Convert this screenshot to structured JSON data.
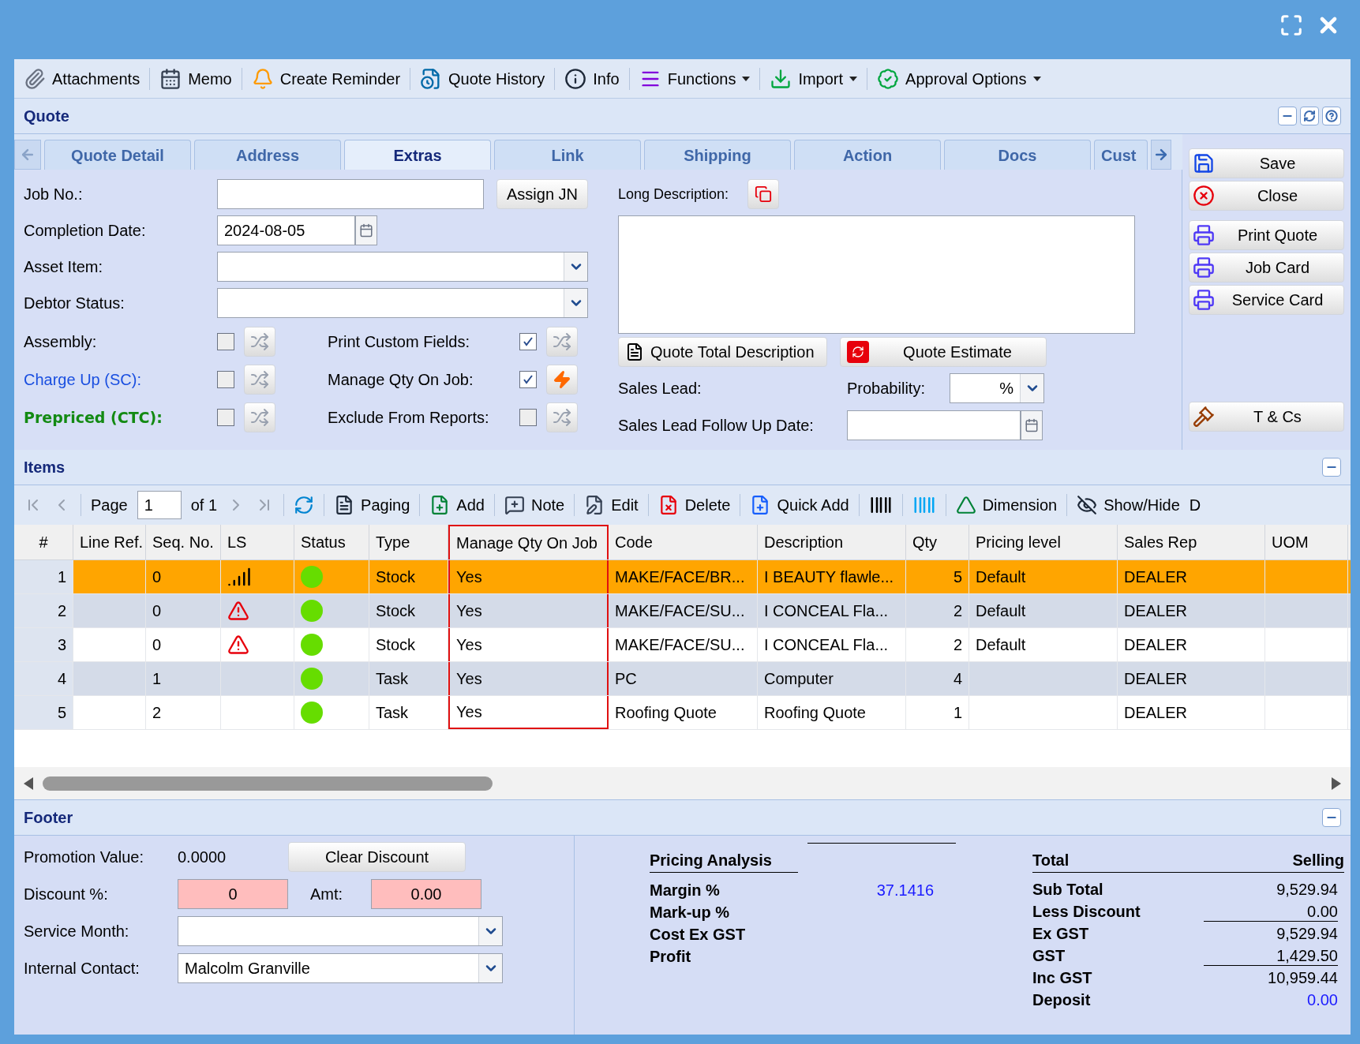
{
  "toolbar": [
    {
      "label": "Attachments",
      "kind": "attach",
      "dropdown": false
    },
    {
      "label": "Memo",
      "kind": "memo",
      "dropdown": false
    },
    {
      "label": "Create Reminder",
      "kind": "bell",
      "dropdown": false
    },
    {
      "label": "Quote History",
      "kind": "history",
      "dropdown": false
    },
    {
      "label": "Info",
      "kind": "info",
      "dropdown": false
    },
    {
      "label": "Functions",
      "kind": "menu",
      "dropdown": true
    },
    {
      "label": "Import",
      "kind": "import",
      "dropdown": true
    },
    {
      "label": "Approval Options",
      "kind": "approval",
      "dropdown": true
    }
  ],
  "quote": {
    "title": "Quote"
  },
  "tabs": [
    {
      "label": "Quote Detail",
      "selected": false
    },
    {
      "label": "Address",
      "selected": false
    },
    {
      "label": "Extras",
      "selected": true
    },
    {
      "label": "Link",
      "selected": false
    },
    {
      "label": "Shipping",
      "selected": false
    },
    {
      "label": "Action",
      "selected": false
    },
    {
      "label": "Docs",
      "selected": false
    },
    {
      "label": "Cust",
      "selected": false
    }
  ],
  "fields": [
    {
      "kind": "text",
      "label": "Job No.:",
      "button": "Assign JN"
    },
    {
      "kind": "date",
      "label": "Completion Date:",
      "value": "2024-08-05"
    },
    {
      "kind": "select",
      "label": "Asset Item:"
    },
    {
      "kind": "select",
      "label": "Debtor Status:"
    }
  ],
  "flags": [
    {
      "label": "Assembly:",
      "kind": "plain",
      "checked": false,
      "action": {
        "kind": "shuffle"
      }
    },
    {
      "label": "Print Custom Fields:",
      "kind": "plain",
      "checked": true,
      "action": {
        "kind": "shuffle"
      }
    },
    {
      "label": "Charge Up (SC):",
      "kind": "link",
      "checked": false,
      "action": {
        "kind": "shuffle"
      }
    },
    {
      "label": "Manage Qty On Job:",
      "kind": "plain",
      "checked": true,
      "action": {
        "kind": "bolt"
      }
    },
    {
      "label": "Prepriced (CTC):",
      "kind": "highlight",
      "checked": false,
      "action": {
        "kind": "shuffle"
      }
    },
    {
      "label": "Exclude From Reports:",
      "kind": "plain",
      "checked": false,
      "action": {
        "kind": "shuffle"
      }
    }
  ],
  "long_description": {
    "label": "Long Description:"
  },
  "description_buttons": [
    {
      "label": "Quote Total Description",
      "kind": "doc"
    },
    {
      "label": "Quote Estimate",
      "kind": "estimate"
    }
  ],
  "sales_lead": {
    "label": "Sales Lead:",
    "probability_label": "Probability:",
    "probability_unit": "%",
    "follow_up_label": "Sales Lead Follow Up Date:"
  },
  "side_button_groups": [
    [
      {
        "label": "Save",
        "kind": "save"
      },
      {
        "label": "Close",
        "kind": "close"
      }
    ],
    [
      {
        "label": "Print Quote",
        "kind": "print"
      },
      {
        "label": "Job Card",
        "kind": "print"
      },
      {
        "label": "Service Card",
        "kind": "print"
      }
    ],
    [
      {
        "label": "T & Cs",
        "kind": "gavel"
      }
    ]
  ],
  "items": {
    "title": "Items",
    "page_label": "Page",
    "page": "1",
    "page_count": "of 1",
    "tools": [
      {
        "label": "Paging",
        "kind": "doc"
      },
      {
        "label": "Add",
        "kind": "add"
      },
      {
        "label": "Note",
        "kind": "note"
      },
      {
        "label": "Edit",
        "kind": "edit"
      },
      {
        "label": "Delete",
        "kind": "delete"
      },
      {
        "label": "Quick Add",
        "kind": "quickadd"
      },
      {
        "kind": "barcode"
      },
      {
        "kind": "barcode_blue"
      },
      {
        "label": "Dimension",
        "kind": "dimension"
      },
      {
        "label": "Show/Hide",
        "kind": "hide"
      },
      {
        "label": "D",
        "kind": "text"
      }
    ],
    "columns": [
      {
        "label": "#",
        "highlighted": false
      },
      {
        "label": "Line Ref.",
        "highlighted": false
      },
      {
        "label": "Seq. No.",
        "highlighted": false
      },
      {
        "label": "LS",
        "highlighted": false
      },
      {
        "label": "Status",
        "highlighted": false
      },
      {
        "label": "Type",
        "highlighted": false
      },
      {
        "label": "Manage Qty On Job",
        "highlighted": true
      },
      {
        "label": "Code",
        "highlighted": false
      },
      {
        "label": "Description",
        "highlighted": false
      },
      {
        "label": "Qty",
        "highlighted": false
      },
      {
        "label": "Pricing level",
        "highlighted": false
      },
      {
        "label": "Sales Rep",
        "highlighted": false
      },
      {
        "label": "UOM",
        "highlighted": false
      }
    ],
    "rows": [
      {
        "num": "1",
        "seq": "0",
        "ls": {
          "kind": "level"
        },
        "status": {
          "color": "#66dd00"
        },
        "type": "Stock",
        "manage": "Yes",
        "code": "MAKE/FACE/BR...",
        "description": "I BEAUTY flawle...",
        "qty": "5",
        "pricing": "Default",
        "rep": "DEALER",
        "selected": true
      },
      {
        "num": "2",
        "seq": "0",
        "ls": {
          "kind": "warning"
        },
        "status": {
          "color": "#66dd00"
        },
        "type": "Stock",
        "manage": "Yes",
        "code": "MAKE/FACE/SU...",
        "description": "I CONCEAL Fla...",
        "qty": "2",
        "pricing": "Default",
        "rep": "DEALER",
        "selected": false
      },
      {
        "num": "3",
        "seq": "0",
        "ls": {
          "kind": "warning"
        },
        "status": {
          "color": "#66dd00"
        },
        "type": "Stock",
        "manage": "Yes",
        "code": "MAKE/FACE/SU...",
        "description": "I CONCEAL Fla...",
        "qty": "2",
        "pricing": "Default",
        "rep": "DEALER",
        "selected": false
      },
      {
        "num": "4",
        "seq": "1",
        "status": {
          "color": "#66dd00"
        },
        "type": "Task",
        "manage": "Yes",
        "code": "PC",
        "description": "Computer",
        "qty": "4",
        "rep": "DEALER",
        "selected": false
      },
      {
        "num": "5",
        "seq": "2",
        "status": {
          "color": "#66dd00"
        },
        "type": "Task",
        "manage": "Yes",
        "code": "Roofing Quote",
        "description": "Roofing Quote",
        "qty": "1",
        "rep": "DEALER",
        "selected": false
      }
    ]
  },
  "footer": {
    "title": "Footer",
    "promotion_label": "Promotion Value:",
    "promotion_value": "0.0000",
    "clear_button": "Clear Discount",
    "discount_label": "Discount %:",
    "discount_value": "0",
    "amount_label": "Amt:",
    "amount_value": "0.00",
    "service_month_label": "Service Month:",
    "contact_label": "Internal Contact:",
    "contact_value": "Malcolm Granville",
    "pricing": {
      "title": "Pricing Analysis",
      "rows": [
        {
          "label": "Margin %",
          "value": "37.1416"
        },
        {
          "label": "Mark-up %"
        },
        {
          "label": "Cost Ex GST"
        },
        {
          "label": "Profit"
        }
      ]
    },
    "totals": {
      "title": "Total",
      "column": "Selling",
      "rows": [
        {
          "label": "Sub Total",
          "value": "9,529.94",
          "kind": "plain"
        },
        {
          "label": "Less Discount",
          "value": "0.00",
          "kind": "plain"
        },
        {
          "label": "Ex GST",
          "value": "9,529.94",
          "kind": "ruled"
        },
        {
          "label": "GST",
          "value": "1,429.50",
          "kind": "plain"
        },
        {
          "label": "Inc GST",
          "value": "10,959.44",
          "kind": "ruled"
        },
        {
          "label": "Deposit",
          "value": "0.00",
          "kind": "link"
        }
      ]
    }
  }
}
